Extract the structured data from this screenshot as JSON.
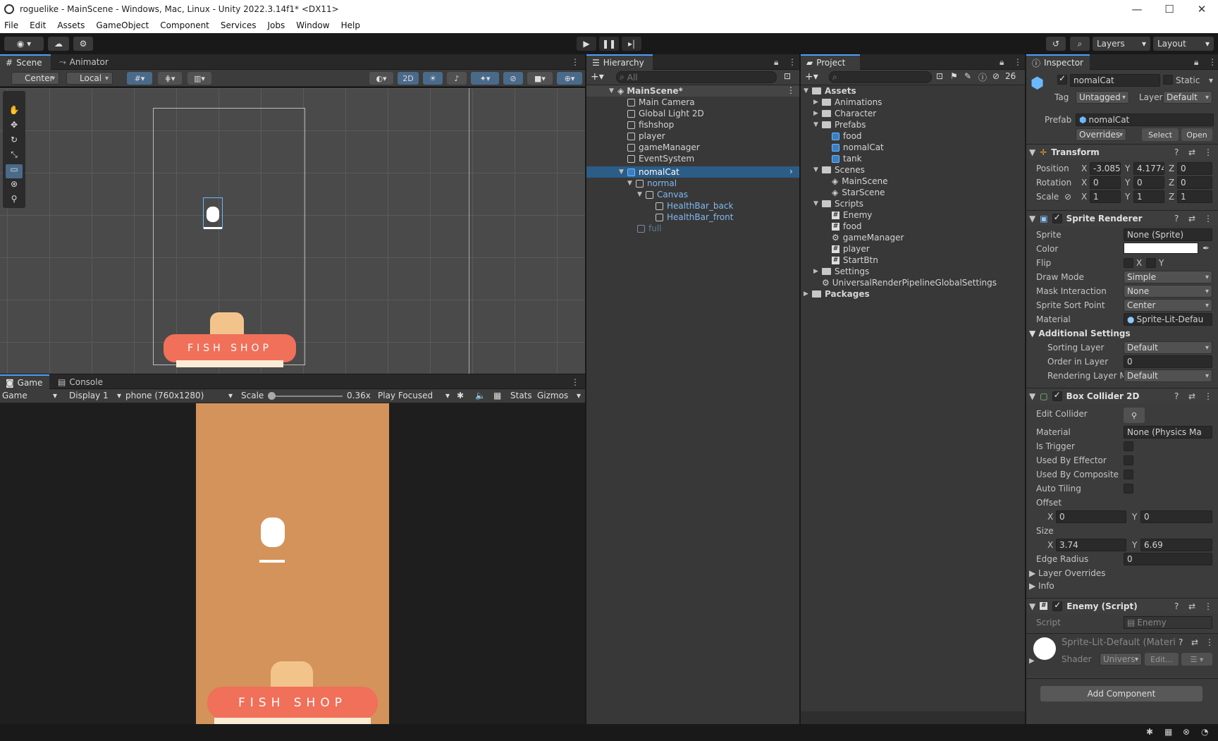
{
  "window": {
    "title": "roguelike - MainScene - Windows, Mac, Linux - Unity 2022.3.14f1* <DX11>",
    "min": "—",
    "max": "☐",
    "close": "✕"
  },
  "menu": [
    "File",
    "Edit",
    "Assets",
    "GameObject",
    "Component",
    "Services",
    "Jobs",
    "Window",
    "Help"
  ],
  "toolbar": {
    "layers": "Layers",
    "layout": "Layout"
  },
  "scene": {
    "tab_scene": "Scene",
    "tab_animator": "Animator",
    "pivot": "Center",
    "space": "Local",
    "mode2d": "2D"
  },
  "game": {
    "tab_game": "Game",
    "tab_console": "Console",
    "view": "Game",
    "display": "Display 1",
    "resolution": "phone (760x1280)",
    "scale_label": "Scale",
    "scale_value": "0.36x",
    "play_mode": "Play Focused",
    "stats": "Stats",
    "gizmos": "Gizmos",
    "shop_sign": "FISH  SHOP"
  },
  "hierarchy": {
    "title": "Hierarchy",
    "search": "All",
    "items": [
      {
        "label": "MainScene*",
        "depth": 0
      },
      {
        "label": "Main Camera",
        "depth": 1
      },
      {
        "label": "Global Light 2D",
        "depth": 1
      },
      {
        "label": "fishshop",
        "depth": 1
      },
      {
        "label": "player",
        "depth": 1
      },
      {
        "label": "gameManager",
        "depth": 1
      },
      {
        "label": "EventSystem",
        "depth": 1
      },
      {
        "label": "nomalCat",
        "depth": 1
      },
      {
        "label": "normal",
        "depth": 2
      },
      {
        "label": "Canvas",
        "depth": 3
      },
      {
        "label": "HealthBar_back",
        "depth": 4
      },
      {
        "label": "HealthBar_front",
        "depth": 4
      },
      {
        "label": "full",
        "depth": 2
      }
    ]
  },
  "project": {
    "title": "Project",
    "count": "26",
    "items": [
      {
        "label": "Assets",
        "depth": 0,
        "kind": "folder"
      },
      {
        "label": "Animations",
        "depth": 1,
        "kind": "folder"
      },
      {
        "label": "Character",
        "depth": 1,
        "kind": "folder"
      },
      {
        "label": "Prefabs",
        "depth": 1,
        "kind": "folder"
      },
      {
        "label": "food",
        "depth": 2,
        "kind": "prefab"
      },
      {
        "label": "nomalCat",
        "depth": 2,
        "kind": "prefab"
      },
      {
        "label": "tank",
        "depth": 2,
        "kind": "prefab"
      },
      {
        "label": "Scenes",
        "depth": 1,
        "kind": "folder"
      },
      {
        "label": "MainScene",
        "depth": 2,
        "kind": "scene"
      },
      {
        "label": "StarScene",
        "depth": 2,
        "kind": "scene"
      },
      {
        "label": "Scripts",
        "depth": 1,
        "kind": "folder"
      },
      {
        "label": "Enemy",
        "depth": 2,
        "kind": "script"
      },
      {
        "label": "food",
        "depth": 2,
        "kind": "script"
      },
      {
        "label": "gameManager",
        "depth": 2,
        "kind": "gear"
      },
      {
        "label": "player",
        "depth": 2,
        "kind": "script"
      },
      {
        "label": "StartBtn",
        "depth": 2,
        "kind": "script"
      },
      {
        "label": "Settings",
        "depth": 1,
        "kind": "folder"
      },
      {
        "label": "UniversalRenderPipelineGlobalSettings",
        "depth": 1,
        "kind": "asset"
      },
      {
        "label": "Packages",
        "depth": 0,
        "kind": "folder"
      }
    ]
  },
  "inspector": {
    "title": "Inspector",
    "name": "nomalCat",
    "static": "Static",
    "tag_label": "Tag",
    "tag": "Untagged",
    "layer_label": "Layer",
    "layer": "Default",
    "prefab_label": "Prefab",
    "prefab": "nomalCat",
    "overrides": "Overrides",
    "select": "Select",
    "open": "Open",
    "transform": {
      "title": "Transform",
      "position": "Position",
      "rotation": "Rotation",
      "scale": "Scale",
      "px": "-3.085",
      "py": "4.1774",
      "pz": "0",
      "rx": "0",
      "ry": "0",
      "rz": "0",
      "sx": "1",
      "sy": "1",
      "sz": "1",
      "x": "X",
      "y": "Y",
      "z": "Z"
    },
    "sprite": {
      "title": "Sprite Renderer",
      "sprite_label": "Sprite",
      "sprite": "None (Sprite)",
      "color_label": "Color",
      "flip_label": "Flip",
      "flip_x": "X",
      "flip_y": "Y",
      "draw_mode_label": "Draw Mode",
      "draw_mode": "Simple",
      "mask_label": "Mask Interaction",
      "mask": "None",
      "sort_point_label": "Sprite Sort Point",
      "sort_point": "Center",
      "material_label": "Material",
      "material": "Sprite-Lit-Defau",
      "additional": "Additional Settings",
      "sorting_layer_label": "Sorting Layer",
      "sorting_layer": "Default",
      "order_label": "Order in Layer",
      "order": "0",
      "rendering_layer_label": "Rendering Layer M",
      "rendering_layer": "Default"
    },
    "box": {
      "title": "Box Collider 2D",
      "edit_label": "Edit Collider",
      "material_label": "Material",
      "material": "None (Physics Ma",
      "trigger_label": "Is Trigger",
      "effector_label": "Used By Effector",
      "composite_label": "Used By Composite",
      "autotile_label": "Auto Tiling",
      "offset_label": "Offset",
      "ox": "0",
      "oy": "0",
      "size_label": "Size",
      "sx": "3.74",
      "sy": "6.69",
      "edge_label": "Edge Radius",
      "edge": "0",
      "overrides_label": "Layer Overrides",
      "info_label": "Info",
      "x": "X",
      "y": "Y"
    },
    "enemy": {
      "title": "Enemy (Script)",
      "script_label": "Script",
      "script": "Enemy"
    },
    "mat": {
      "title": "Sprite-Lit-Default (Materi",
      "shader_label": "Shader",
      "shader": "Univers",
      "edit": "Edit..."
    },
    "add_component": "Add Component"
  },
  "colors": {
    "accent": "#4a9fff",
    "selection": "#2c5d87",
    "game_bg": "#d4935a",
    "shop_red": "#f0705a"
  }
}
